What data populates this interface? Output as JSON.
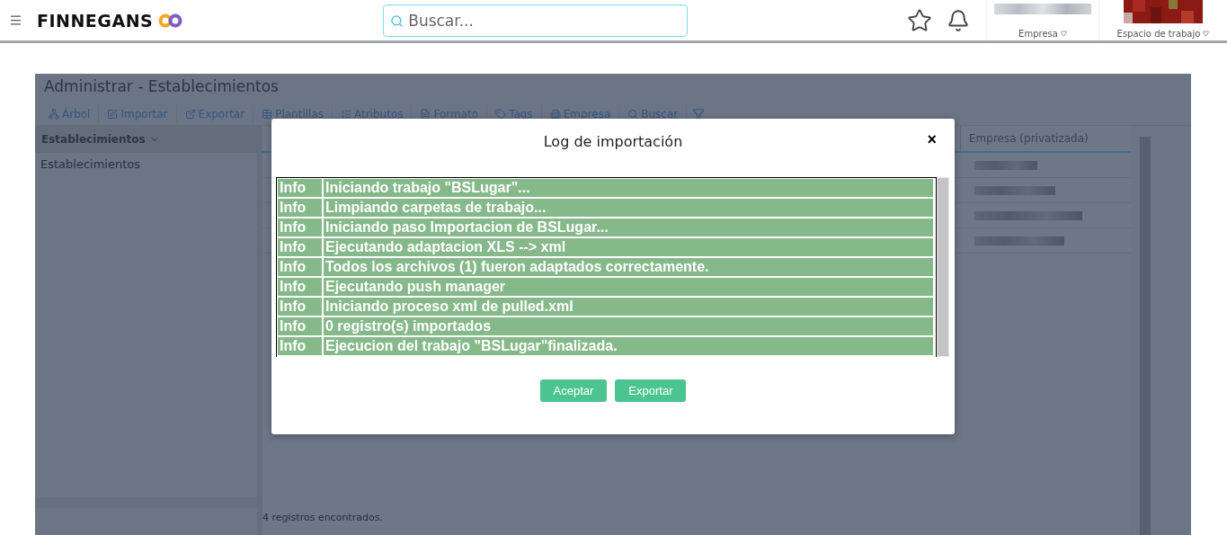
{
  "header": {
    "brand": "FINNEGANS",
    "search": {
      "placeholder": "Buscar..."
    },
    "company_label": "Empresa",
    "workspace_label": "Espacio de trabajo"
  },
  "page": {
    "title": "Administrar - Establecimientos",
    "toolbar": [
      "Árbol",
      "Importar",
      "Exportar",
      "Plantillas",
      "Atributos",
      "Formato",
      "Tags",
      "Empresa",
      "Buscar"
    ],
    "tree": {
      "header": "Establecimientos",
      "items": [
        "Establecimientos"
      ]
    },
    "grid": {
      "column_1": "Empresa (privatizada)"
    },
    "status": "4 registros encontrados."
  },
  "dialog": {
    "title": "Log de importación",
    "close": "×",
    "log": [
      {
        "level": "Info",
        "message": "Iniciando trabajo \"BSLugar\"..."
      },
      {
        "level": "Info",
        "message": "Limpiando carpetas de trabajo..."
      },
      {
        "level": "Info",
        "message": "Iniciando paso Importacion de BSLugar..."
      },
      {
        "level": "Info",
        "message": "Ejecutando adaptacion XLS --> xml"
      },
      {
        "level": "Info",
        "message": "Todos los archivos (1) fueron adaptados correctamente."
      },
      {
        "level": "Info",
        "message": "Ejecutando push manager"
      },
      {
        "level": "Info",
        "message": "Iniciando proceso xml de pulled.xml"
      },
      {
        "level": "Info",
        "message": "0 registro(s) importados"
      },
      {
        "level": "Info",
        "message": "Ejecucion del trabajo \"BSLugar\"finalizada."
      }
    ],
    "buttons": [
      "Aceptar",
      "Exportar"
    ]
  }
}
